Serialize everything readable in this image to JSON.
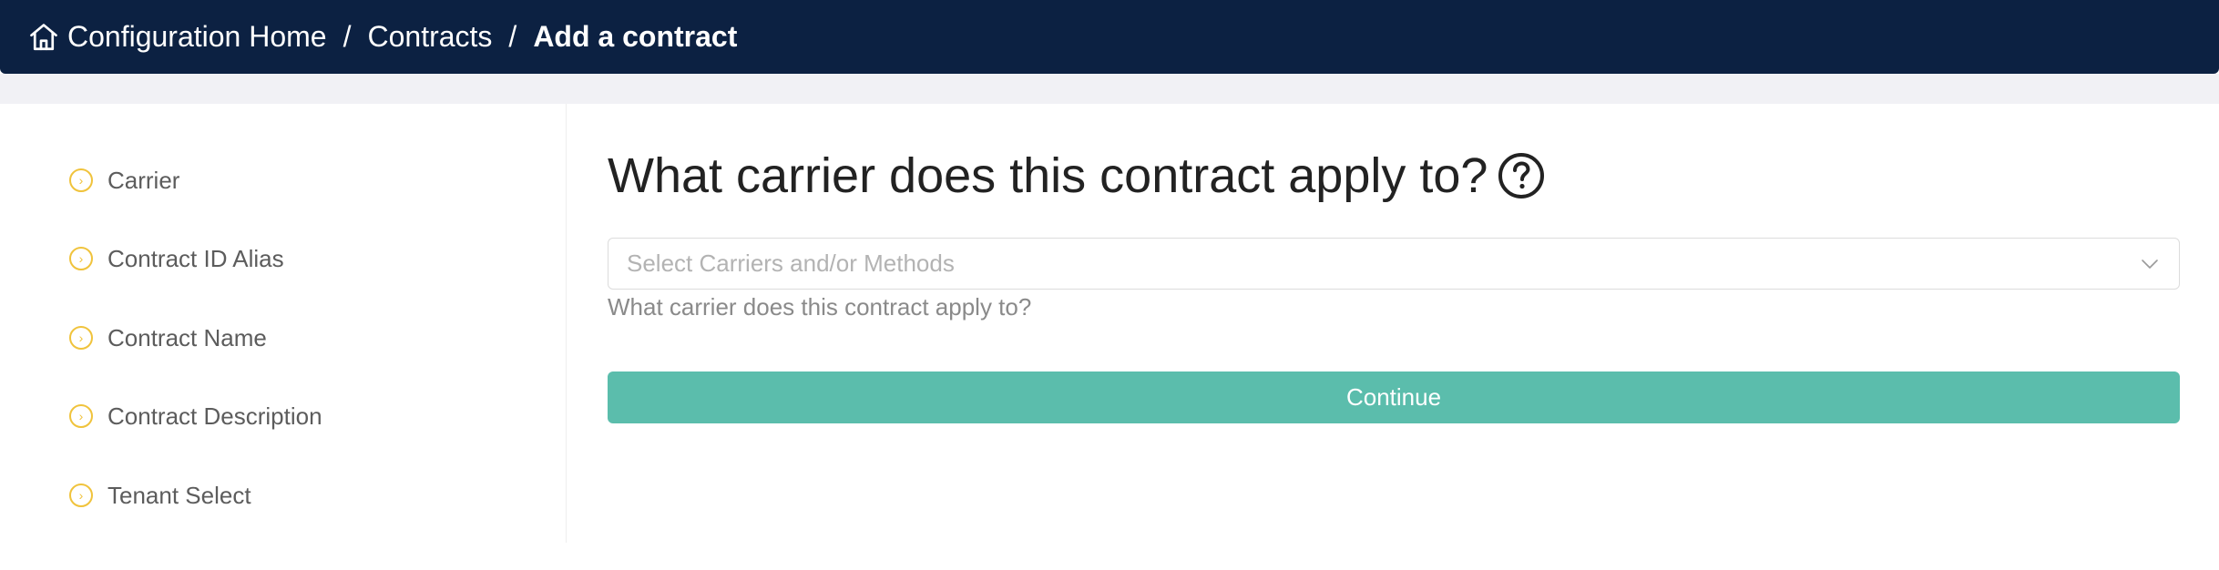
{
  "breadcrumb": {
    "home_icon": "home-icon",
    "items": [
      {
        "label": "Configuration Home"
      },
      {
        "label": "Contracts"
      },
      {
        "label": "Add a contract"
      }
    ],
    "separator": "/"
  },
  "sidebar": {
    "step_icon": "chevron-right-circle-icon",
    "items": [
      {
        "label": "Carrier"
      },
      {
        "label": "Contract ID Alias"
      },
      {
        "label": "Contract Name"
      },
      {
        "label": "Contract Description"
      },
      {
        "label": "Tenant Select"
      }
    ]
  },
  "main": {
    "question": "What carrier does this contract apply to?",
    "help_icon": "question-circle-icon",
    "select": {
      "placeholder": "Select Carriers and/or Methods",
      "value": ""
    },
    "helper_text": "What carrier does this contract apply to?",
    "continue_label": "Continue"
  },
  "colors": {
    "topbar": "#0c2142",
    "accent_yellow": "#f0c33c",
    "continue_button": "#5bbdac",
    "band": "#f1f1f5"
  }
}
